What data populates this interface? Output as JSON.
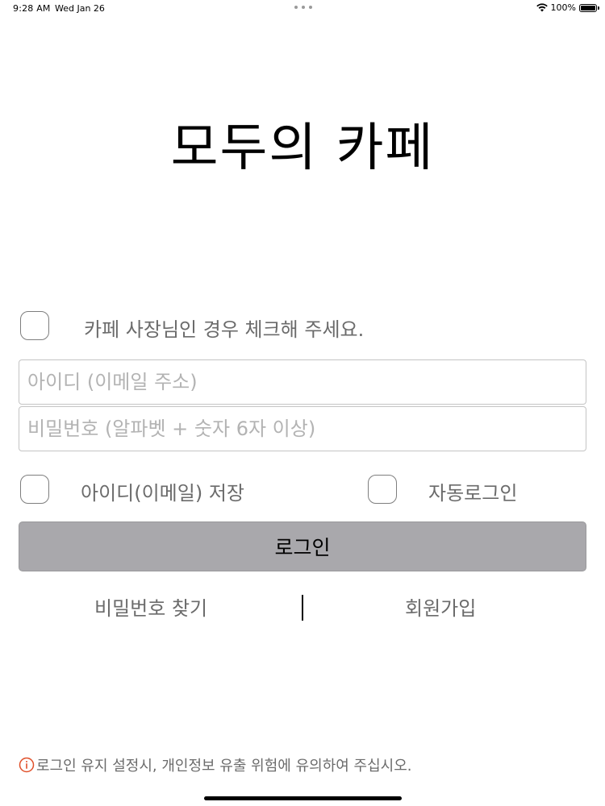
{
  "status_bar": {
    "time": "9:28 AM",
    "date": "Wed Jan 26",
    "battery_percent": "100%",
    "battery_level": 1.0
  },
  "title": "모두의 카페",
  "owner_checkbox": {
    "label": "카페 사장님인 경우 체크해 주세요.",
    "checked": false
  },
  "id_field": {
    "placeholder": "아이디 (이메일 주소)",
    "value": ""
  },
  "password_field": {
    "placeholder": "비밀번호 (알파벳 + 숫자 6자 이상)",
    "value": ""
  },
  "save_id_checkbox": {
    "label": "아이디(이메일) 저장",
    "checked": false
  },
  "auto_login_checkbox": {
    "label": "자동로그인",
    "checked": false
  },
  "login_button": {
    "label": "로그인"
  },
  "links": {
    "find_password": "비밀번호 찾기",
    "sign_up": "회원가입"
  },
  "notice": {
    "icon": "info-circle-icon",
    "text": "로그인 유지 설정시, 개인정보 유출 위험에 유의하여 주십시오."
  },
  "colors": {
    "login_button_bg": "#a9a8ac",
    "notice_icon": "#e0502a",
    "label_text": "#6b6b6b"
  }
}
